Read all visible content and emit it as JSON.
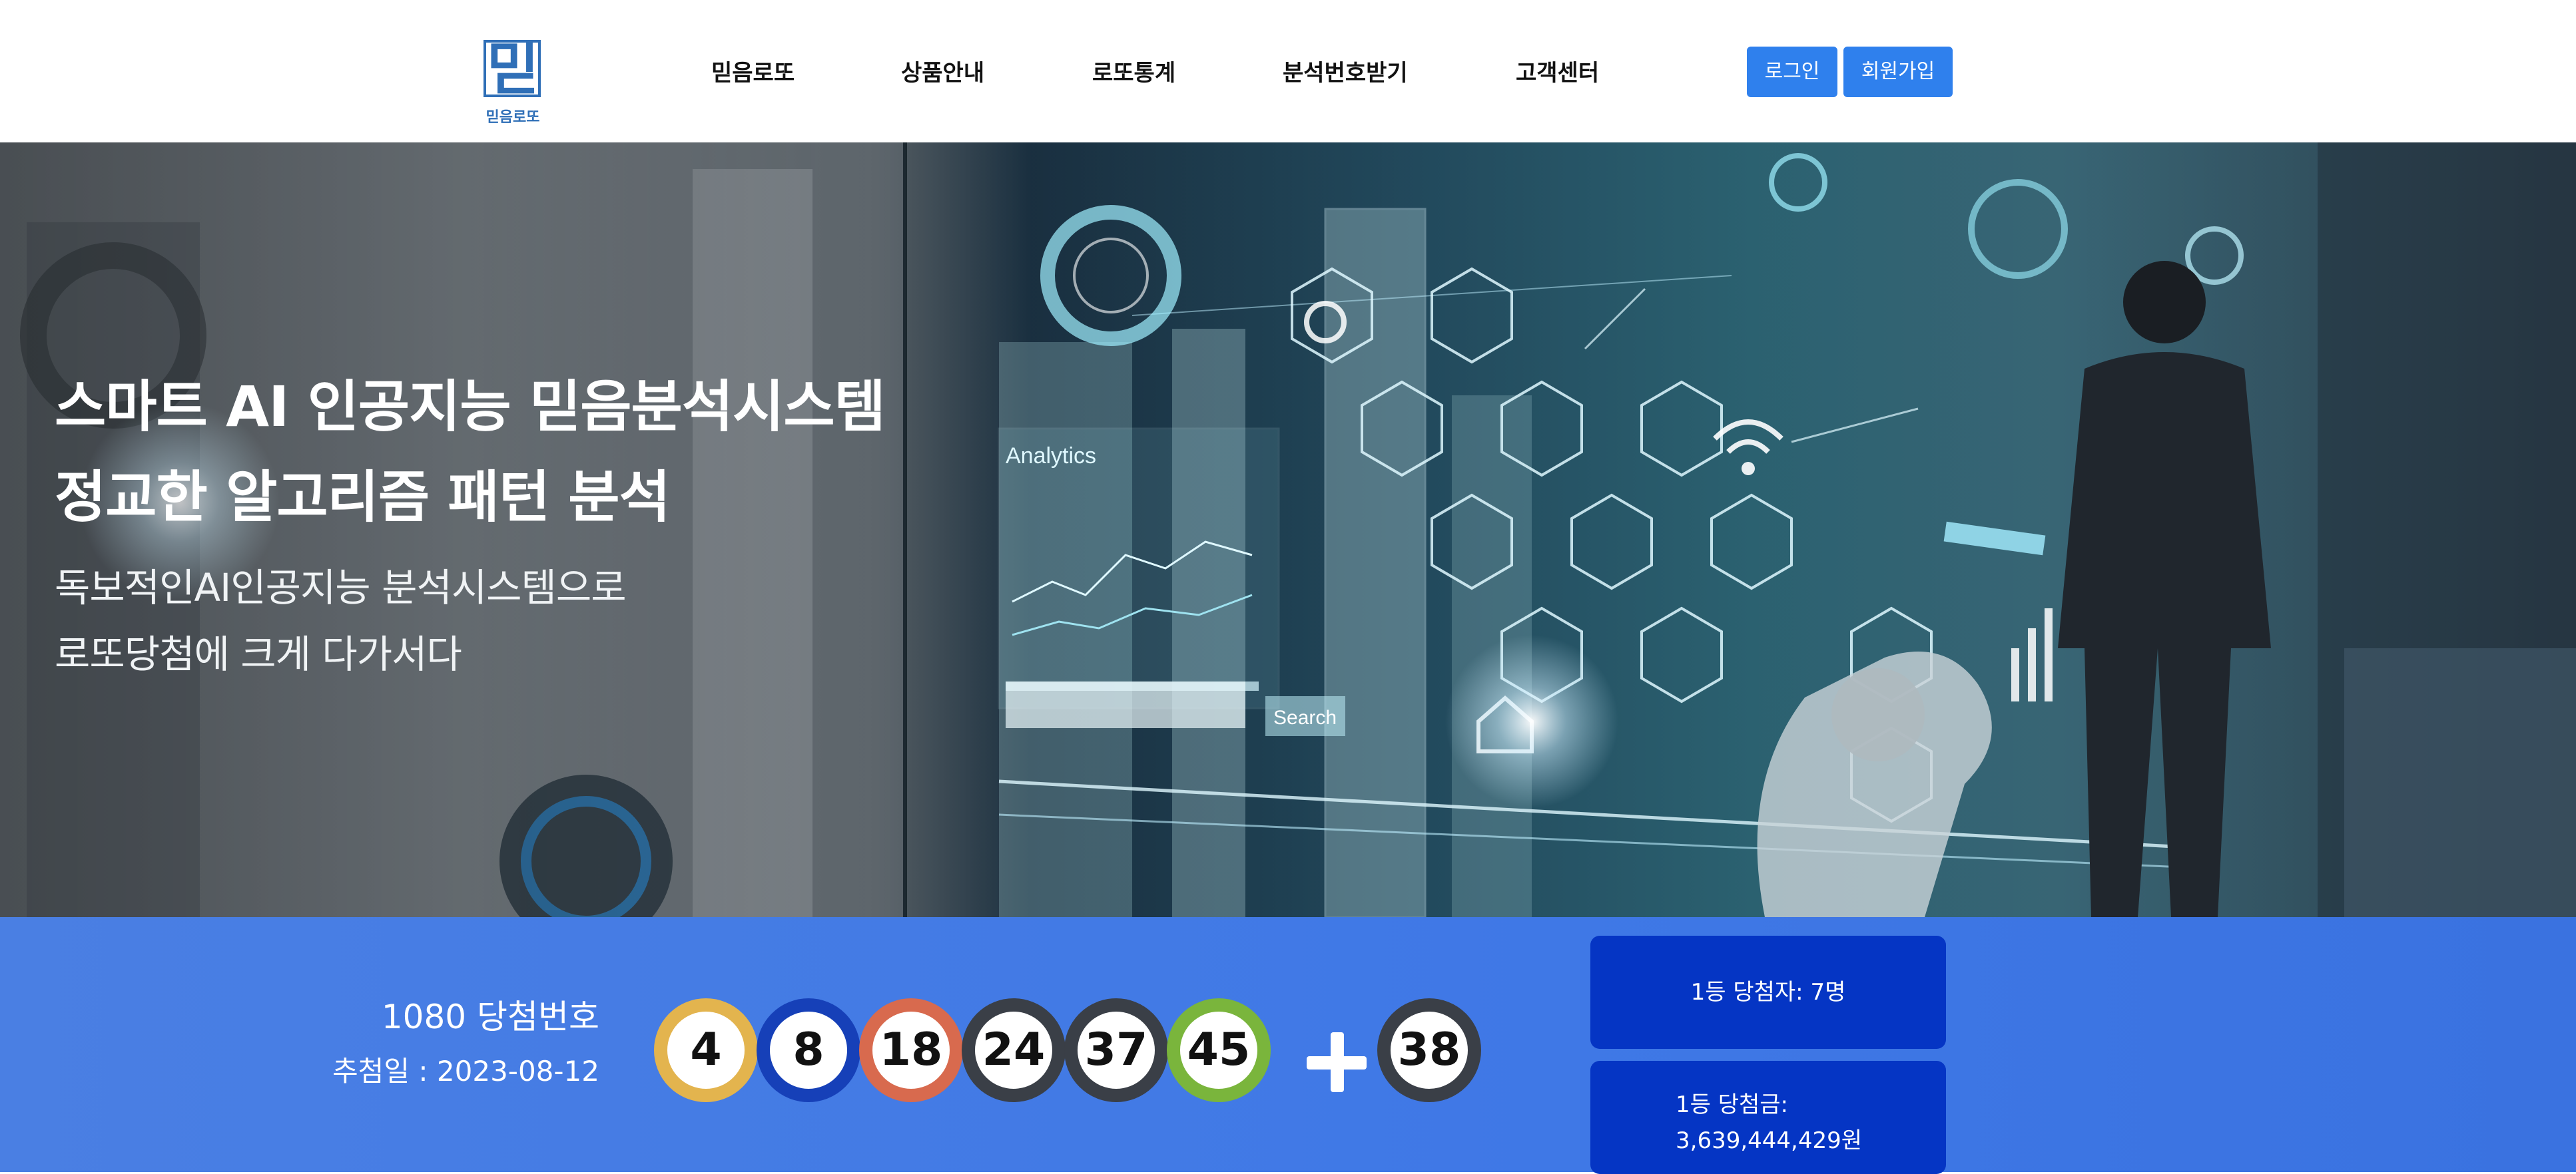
{
  "header": {
    "logo": {
      "glyph": "믿",
      "text": "믿음로또"
    },
    "nav": [
      {
        "label": "믿음로또"
      },
      {
        "label": "상품안내"
      },
      {
        "label": "로또통계"
      },
      {
        "label": "분석번호받기"
      },
      {
        "label": "고객센터"
      }
    ],
    "login_label": "로그인",
    "signup_label": "회원가입"
  },
  "hero": {
    "title_line1": "스마트 AI 인공지능 믿음분석시스템",
    "title_line2": "정교한 알고리즘 패턴 분석",
    "sub_line1": "독보적인AI인공지능 분석시스템으로",
    "sub_line2": "로또당첨에 크게 다가서다",
    "image_texts": {
      "analytics": "Analytics",
      "search": "Search"
    }
  },
  "draw": {
    "round_label": "1080 당첨번호",
    "date_label": "추첨일 : 2023-08-12",
    "numbers": [
      {
        "value": "4",
        "color": "#e3b44e"
      },
      {
        "value": "8",
        "color": "#1640b8"
      },
      {
        "value": "18",
        "color": "#d86a4e"
      },
      {
        "value": "24",
        "color": "#3a3f47"
      },
      {
        "value": "37",
        "color": "#3a3f47"
      },
      {
        "value": "45",
        "color": "#7ab53c"
      }
    ],
    "bonus": {
      "value": "38",
      "color": "#3a3f47"
    },
    "winners_label": "1등 당첨자: 7명",
    "prize_label": "1등 당첨금:",
    "prize_amount": "3,639,444,429원"
  },
  "colors": {
    "accent": "#2f80ed",
    "strip": "#3f78e6",
    "info_box": "#0535c4",
    "logo": "#2f6fb7"
  }
}
